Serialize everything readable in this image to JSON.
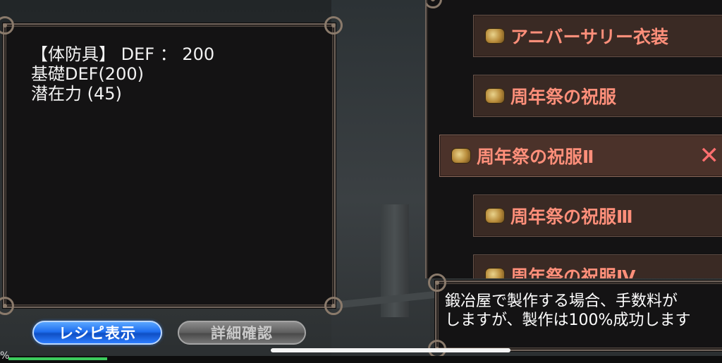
{
  "stats": {
    "line1": "【体防具】 DEF ： 200",
    "line2": "基礎DEF(200)",
    "line3": "潜在力 (45)"
  },
  "items": [
    {
      "label": "アニバーサリー衣装"
    },
    {
      "label": "周年祭の祝服"
    },
    {
      "label": "周年祭の祝服Ⅱ"
    },
    {
      "label": "周年祭の祝服Ⅲ"
    },
    {
      "label": "周年祭の祝服Ⅳ"
    }
  ],
  "selected_close": "✕",
  "message": {
    "line1": "鍛冶屋で製作する場合、手数料が",
    "line2": "しますが、製作は100%成功します"
  },
  "buttons": {
    "recipe": "レシピ表示",
    "detail": "詳細確認"
  },
  "progress": {
    "label": "%"
  },
  "colors": {
    "item_text": "#ff8f7a",
    "recipe_button": "#1f6ff0",
    "progress": "#3ccc5c"
  }
}
